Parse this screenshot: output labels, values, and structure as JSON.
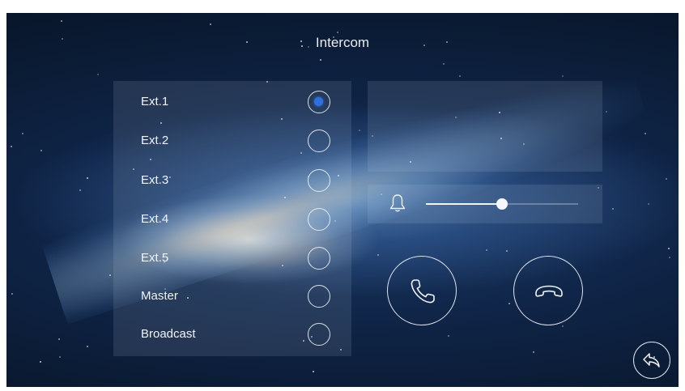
{
  "header": {
    "title": "Intercom"
  },
  "extensions": [
    {
      "label": "Ext.1",
      "selected": true
    },
    {
      "label": "Ext.2",
      "selected": false
    },
    {
      "label": "Ext.3",
      "selected": false
    },
    {
      "label": "Ext.4",
      "selected": false
    },
    {
      "label": "Ext.5",
      "selected": false
    },
    {
      "label": "Master",
      "selected": false
    },
    {
      "label": "Broadcast",
      "selected": false
    }
  ],
  "ringtone_volume": {
    "icon": "bell-icon",
    "level": 0.5
  },
  "actions": {
    "call_icon": "phone-call-icon",
    "hangup_icon": "phone-hangup-icon",
    "back_icon": "back-arrow-icon"
  },
  "colors": {
    "accent": "#2e6fe0",
    "text": "#f2f4f8",
    "panel": "rgba(190,205,225,0.13)"
  }
}
